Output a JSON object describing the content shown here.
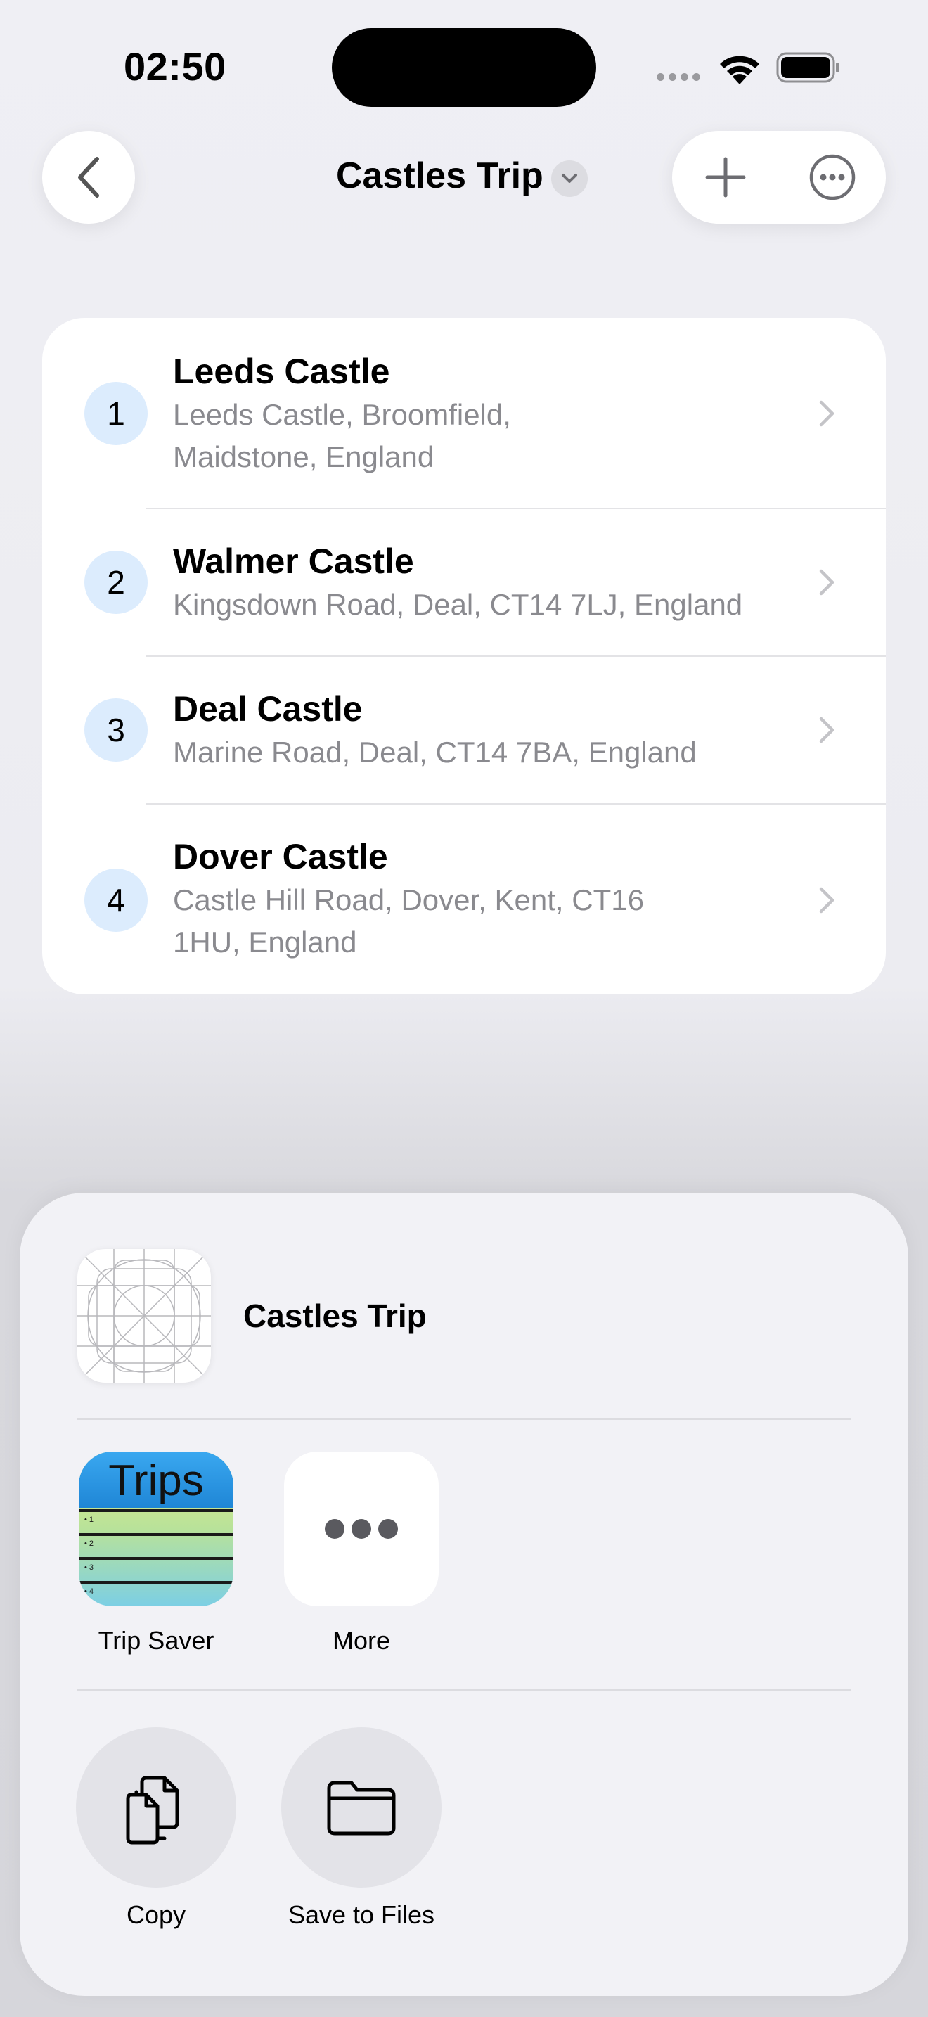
{
  "status_bar": {
    "time": "02:50"
  },
  "nav": {
    "title": "Castles Trip"
  },
  "stops": [
    {
      "number": "1",
      "name": "Leeds Castle",
      "address_line1": "Leeds Castle, Broomfield,",
      "address_line2": "Maidstone, England"
    },
    {
      "number": "2",
      "name": "Walmer Castle",
      "address_line1": "Kingsdown Road, Deal, CT14 7LJ, England",
      "address_line2": ""
    },
    {
      "number": "3",
      "name": "Deal Castle",
      "address_line1": "Marine Road, Deal, CT14 7BA, England",
      "address_line2": ""
    },
    {
      "number": "4",
      "name": "Dover Castle",
      "address_line1": "Castle Hill Road, Dover, Kent, CT16",
      "address_line2": "1HU, England"
    }
  ],
  "share_sheet": {
    "title": "Castles Trip",
    "apps": [
      {
        "label": "Trip Saver",
        "icon_text": "Trips",
        "icon": "trips-app-icon"
      },
      {
        "label": "More",
        "icon": "ellipsis-icon"
      }
    ],
    "actions": [
      {
        "label": "Copy",
        "icon": "copy-icon"
      },
      {
        "label": "Save to Files",
        "icon": "folder-icon"
      }
    ]
  },
  "colors": {
    "badge_bg": "#dcecfd",
    "secondary_text": "#8a8a8f",
    "sheet_bg": "#f2f2f6"
  }
}
